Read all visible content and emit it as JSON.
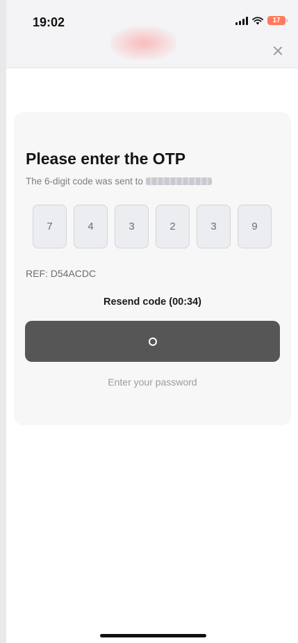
{
  "status_bar": {
    "time": "19:02",
    "battery": "17"
  },
  "colors": {
    "header_bg": "#f4f4f6",
    "card_bg": "#f7f7f8",
    "otp_box_bg": "#ecedf0",
    "button_bg": "#565656",
    "battery": "#ff7a5c"
  },
  "otp": {
    "title": "Please enter the OTP",
    "subtitle": "The 6-digit code was sent to",
    "digits": [
      "7",
      "4",
      "3",
      "2",
      "3",
      "9"
    ],
    "ref": "REF: D54ACDC",
    "resend": "Resend code (00:34)",
    "password_link": "Enter your password"
  }
}
